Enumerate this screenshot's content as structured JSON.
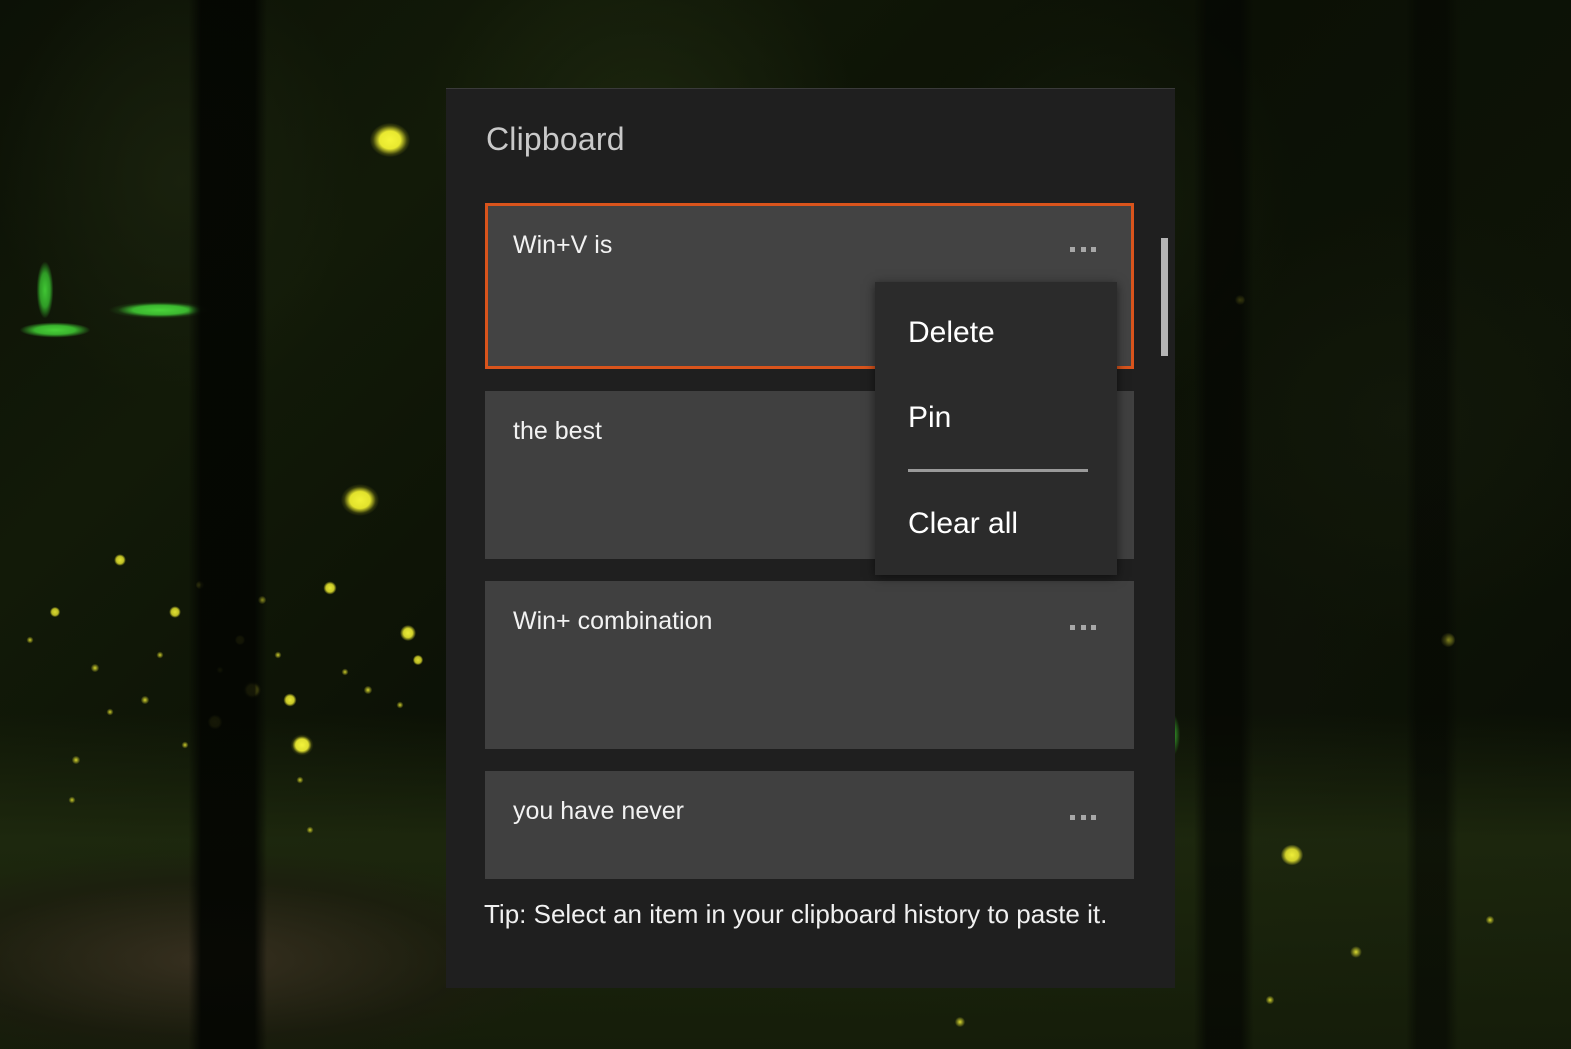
{
  "wallpaper": {
    "description": "night forest with fireflies",
    "colors": {
      "base": "#0c1106",
      "firefly_yellow": "#eded39",
      "glow_green": "#4ad43a"
    }
  },
  "panel": {
    "title": "Clipboard",
    "background": "#1f1f1f",
    "accent": "#d9541c",
    "tip": "Tip: Select an item in your clipboard history to paste it.",
    "items": [
      {
        "text": "Win+V is",
        "selected": true,
        "more_icon": "more-options-icon"
      },
      {
        "text": "the best",
        "selected": false,
        "more_icon": "more-options-icon"
      },
      {
        "text": "Win+ combination",
        "selected": false,
        "more_icon": "more-options-icon"
      },
      {
        "text": "you have never",
        "selected": false,
        "more_icon": "more-options-icon"
      }
    ],
    "scrollbar": {
      "name": "vertical-scrollbar",
      "thumb_color": "#b4b4b4"
    }
  },
  "context_menu": {
    "background": "#2b2b2b",
    "items": [
      {
        "label": "Delete"
      },
      {
        "label": "Pin"
      },
      {
        "label": "Clear all"
      }
    ]
  }
}
